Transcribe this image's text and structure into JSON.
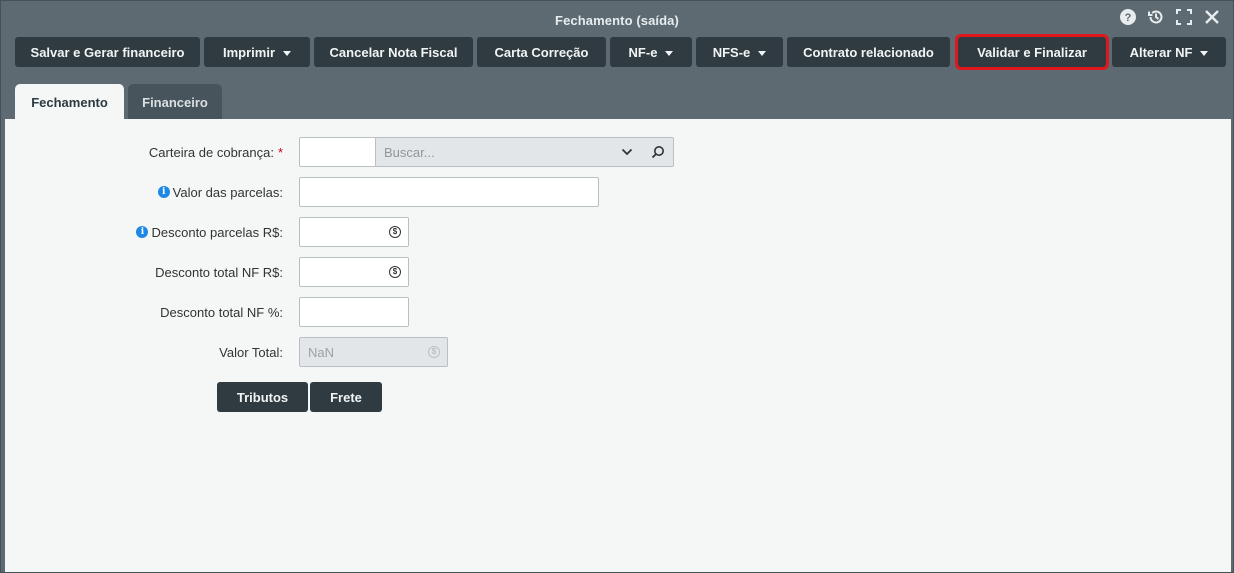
{
  "window": {
    "title": "Fechamento (saída)",
    "controls": [
      "help-icon",
      "history-icon",
      "maximize-icon",
      "close-icon"
    ]
  },
  "toolbar": {
    "salvar_gerar": "Salvar e Gerar financeiro",
    "imprimir": "Imprimir",
    "cancelar_nf": "Cancelar Nota Fiscal",
    "carta_correcao": "Carta Correção",
    "nfe": "NF-e",
    "nfse": "NFS-e",
    "contrato": "Contrato relacionado",
    "validar_finalizar": "Validar e Finalizar",
    "alterar_nf": "Alterar NF",
    "highlight_color": "#e0181e"
  },
  "tabs": [
    {
      "label": "Fechamento",
      "active": true
    },
    {
      "label": "Financeiro",
      "active": false
    }
  ],
  "form": {
    "carteira": {
      "label": "Carteira de cobrança:",
      "required_mark": "*",
      "code_value": "",
      "search_placeholder": "Buscar..."
    },
    "valor_parcelas": {
      "label": "Valor das parcelas:",
      "value": ""
    },
    "desconto_parcelas": {
      "label": "Desconto parcelas R$:",
      "value": ""
    },
    "desconto_total_rs": {
      "label": "Desconto total NF R$:",
      "value": ""
    },
    "desconto_total_pct": {
      "label": "Desconto total NF %:",
      "value": ""
    },
    "valor_total": {
      "label": "Valor Total:",
      "value": "NaN"
    }
  },
  "actions": {
    "tributos": "Tributos",
    "frete": "Frete"
  },
  "colors": {
    "header_bg": "#5d6a71",
    "button_bg": "#2f3b41",
    "content_bg": "#f5f6f6",
    "info_icon": "#1e88e5",
    "required": "#d0021b"
  }
}
